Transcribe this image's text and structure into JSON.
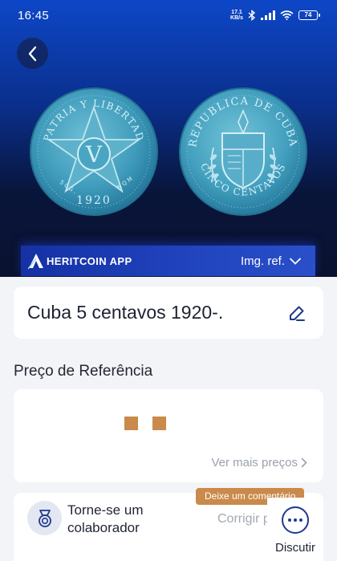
{
  "status_bar": {
    "time": "16:45",
    "net_speed_value": "17.1",
    "net_speed_unit": "KB/s",
    "battery": "74"
  },
  "hero": {
    "brand": "HERITCOIN APP",
    "img_ref_label": "Img. ref.",
    "coin_obverse": {
      "top_text": "PATRIA Y LIBERTAD",
      "center_letter": "V",
      "denomination_left": "5 0 G .",
      "denomination_right": "N Q M",
      "year": "1920"
    },
    "coin_reverse": {
      "top_text": "REPUBLICA DE CUBA",
      "bottom_text": "CINCO CENTAVOS"
    }
  },
  "title_card": {
    "title": "Cuba 5 centavos 1920-."
  },
  "price_section": {
    "heading": "Preço de Referência",
    "more_prices": "Ver mais preços"
  },
  "collaborator": {
    "text_line1": "Torne-se um",
    "text_line2": "colaborador",
    "correct_label": "Corrigir pre"
  },
  "comment_tooltip": "Deixe um comentário",
  "discuss": {
    "label": "Discutir"
  },
  "colors": {
    "accent_gold": "#c98a4b",
    "hero_blue": "#0d47c7",
    "brand_bar": "#1f40bb",
    "icon_navy": "#1e3a8a"
  }
}
